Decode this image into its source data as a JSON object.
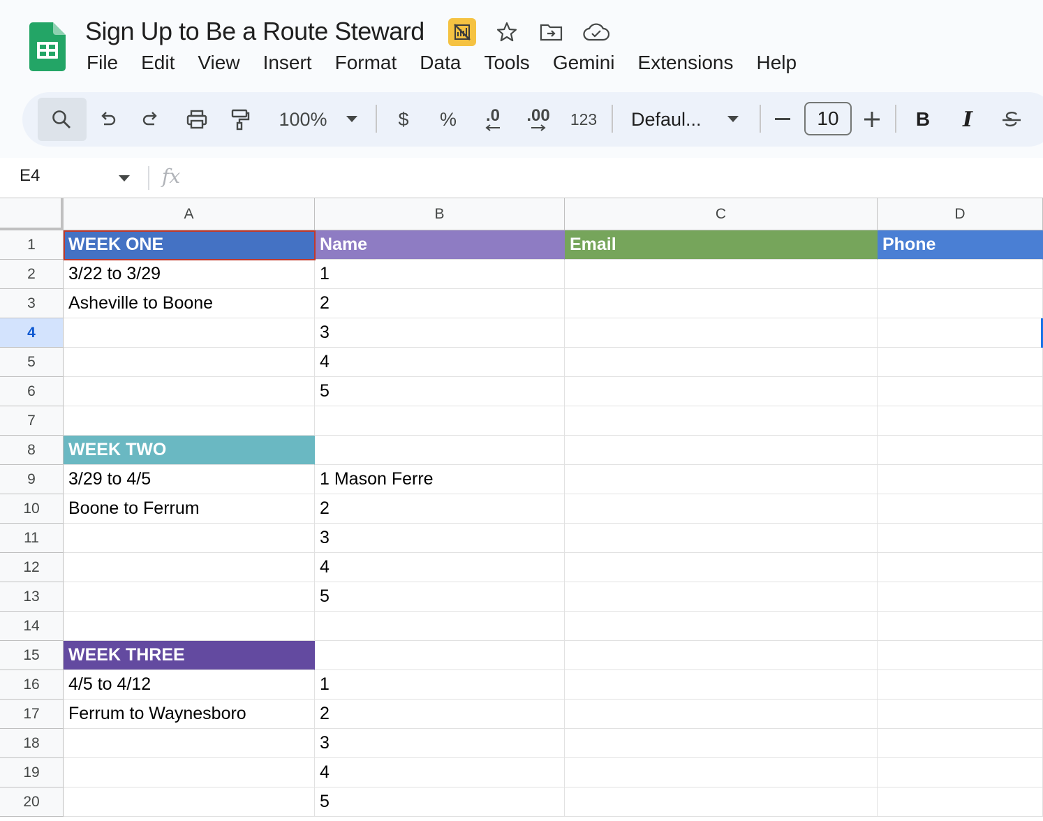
{
  "doc": {
    "title": "Sign Up to Be a Route Steward"
  },
  "menu": [
    "File",
    "Edit",
    "View",
    "Insert",
    "Format",
    "Data",
    "Tools",
    "Gemini",
    "Extensions",
    "Help"
  ],
  "toolbar": {
    "zoom": "100%",
    "currency": "$",
    "percent": "%",
    "dec_decrease": ".0",
    "dec_increase": ".00",
    "number_format": "123",
    "font": "Defaul...",
    "font_size": "10",
    "bold": "B",
    "italic": "I"
  },
  "formula_bar": {
    "name_box": "E4",
    "fx": "fx",
    "content": ""
  },
  "columns": [
    "A",
    "B",
    "C",
    "D"
  ],
  "header_colors": {
    "week_one": "#4472c4",
    "name": "#8e7cc3",
    "email": "#76a55b",
    "phone": "#4a7fd4",
    "week_two": "#6ab8c2",
    "week_three": "#634aa0"
  },
  "rows": [
    {
      "num": "1",
      "a": "WEEK ONE",
      "b": "Name",
      "c": "Email",
      "d": "Phone"
    },
    {
      "num": "2",
      "a": "3/22 to 3/29",
      "b": "1",
      "c": "",
      "d": ""
    },
    {
      "num": "3",
      "a": "Asheville to Boone",
      "b": "2",
      "c": "",
      "d": ""
    },
    {
      "num": "4",
      "a": "",
      "b": "3",
      "c": "",
      "d": ""
    },
    {
      "num": "5",
      "a": "",
      "b": "4",
      "c": "",
      "d": ""
    },
    {
      "num": "6",
      "a": "",
      "b": "5",
      "c": "",
      "d": ""
    },
    {
      "num": "7",
      "a": "",
      "b": "",
      "c": "",
      "d": ""
    },
    {
      "num": "8",
      "a": "WEEK TWO",
      "b": "",
      "c": "",
      "d": ""
    },
    {
      "num": "9",
      "a": "3/29 to 4/5",
      "b": "1 Mason Ferre",
      "c": "",
      "d": ""
    },
    {
      "num": "10",
      "a": "Boone to Ferrum",
      "b": "2",
      "c": "",
      "d": ""
    },
    {
      "num": "11",
      "a": "",
      "b": "3",
      "c": "",
      "d": ""
    },
    {
      "num": "12",
      "a": "",
      "b": "4",
      "c": "",
      "d": ""
    },
    {
      "num": "13",
      "a": "",
      "b": "5",
      "c": "",
      "d": ""
    },
    {
      "num": "14",
      "a": "",
      "b": "",
      "c": "",
      "d": ""
    },
    {
      "num": "15",
      "a": "WEEK THREE",
      "b": "",
      "c": "",
      "d": ""
    },
    {
      "num": "16",
      "a": "4/5 to 4/12",
      "b": "1",
      "c": "",
      "d": ""
    },
    {
      "num": "17",
      "a": "Ferrum to Waynesboro",
      "b": "2",
      "c": "",
      "d": ""
    },
    {
      "num": "18",
      "a": "",
      "b": "3",
      "c": "",
      "d": ""
    },
    {
      "num": "19",
      "a": "",
      "b": "4",
      "c": "",
      "d": ""
    },
    {
      "num": "20",
      "a": "",
      "b": "5",
      "c": "",
      "d": ""
    }
  ]
}
